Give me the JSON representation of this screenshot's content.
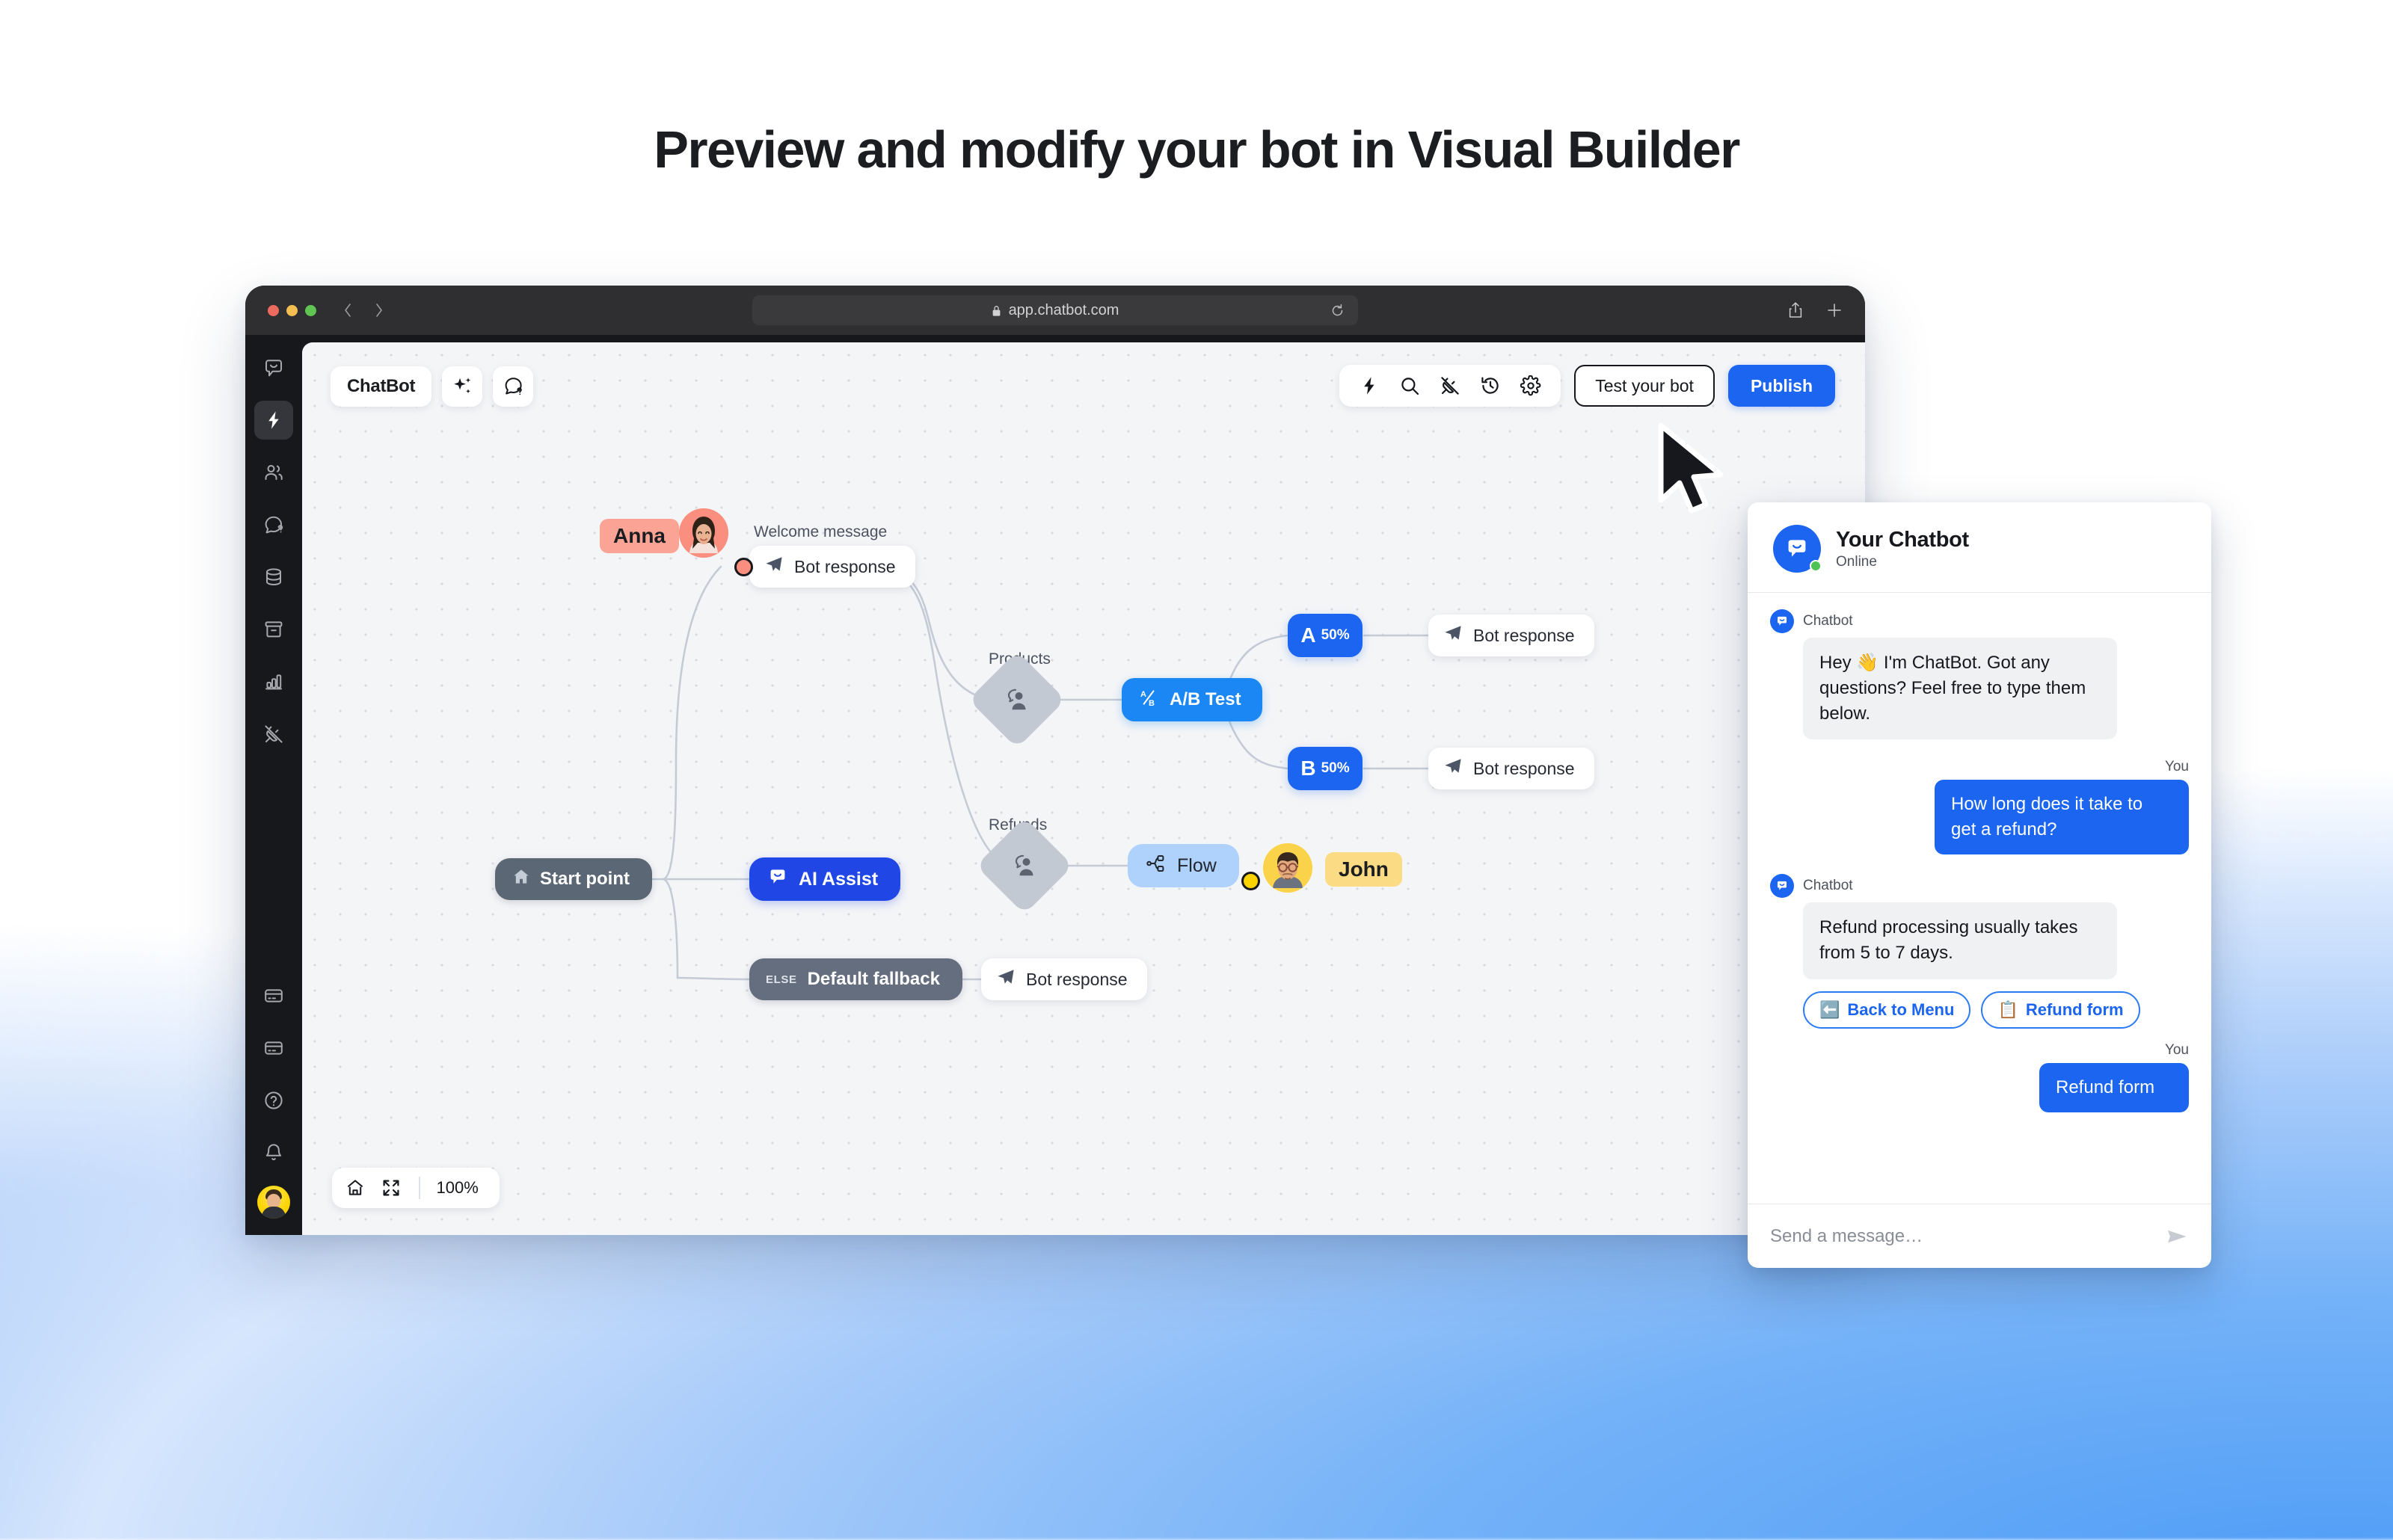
{
  "headline": "Preview and modify your bot in Visual Builder",
  "browser": {
    "url": "app.chatbot.com",
    "lock_icon": "lock-icon",
    "reload_icon": "reload-icon",
    "back_icon": "chevron-left-icon",
    "forward_icon": "chevron-right-icon",
    "share_icon": "share-icon",
    "newtab_icon": "plus-icon"
  },
  "sidebar": {
    "items": [
      {
        "icon": "chatbot-logo-icon",
        "name": "chatbot-logo",
        "active": false
      },
      {
        "icon": "bolt-icon",
        "name": "automations",
        "active": true
      },
      {
        "icon": "users-icon",
        "name": "contacts",
        "active": false
      },
      {
        "icon": "chat-question-icon",
        "name": "conversations",
        "active": false
      },
      {
        "icon": "database-icon",
        "name": "knowledge-base",
        "active": false
      },
      {
        "icon": "archive-icon",
        "name": "archive",
        "active": false
      },
      {
        "icon": "bar-chart-icon",
        "name": "analytics",
        "active": false
      },
      {
        "icon": "plug-icon",
        "name": "integrations",
        "active": false
      }
    ],
    "bottom_items": [
      {
        "icon": "card-icon",
        "name": "billing"
      },
      {
        "icon": "card-icon",
        "name": "subscription"
      },
      {
        "icon": "help-circle-icon",
        "name": "help"
      },
      {
        "icon": "bell-icon",
        "name": "notifications"
      }
    ],
    "avatar": "user-avatar"
  },
  "toolbar": {
    "brand": "ChatBot",
    "ai_icon": "sparkles-icon",
    "help_icon": "chat-question-icon",
    "icons": [
      {
        "icon": "bolt-icon",
        "name": "automations-icon"
      },
      {
        "icon": "search-icon",
        "name": "search-icon"
      },
      {
        "icon": "plug-icon",
        "name": "integrations-icon"
      },
      {
        "icon": "history-icon",
        "name": "history-icon"
      },
      {
        "icon": "gear-icon",
        "name": "settings-icon"
      }
    ],
    "test_label": "Test your bot",
    "publish_label": "Publish"
  },
  "canvas": {
    "nodes": {
      "start_point": "Start point",
      "ai_assist": "AI Assist",
      "welcome_label": "Welcome message",
      "welcome_bot_response": "Bot response",
      "products_label": "Products",
      "ab_test": "A/B Test",
      "variant_a_letter": "A",
      "variant_a_percent": "50%",
      "variant_a_response": "Bot response",
      "variant_b_letter": "B",
      "variant_b_percent": "50%",
      "variant_b_response": "Bot response",
      "refunds_label": "Refunds",
      "flow": "Flow",
      "fallback_tag": "ELSE",
      "fallback": "Default fallback",
      "fallback_response": "Bot response"
    },
    "collaborators": [
      {
        "name": "Anna",
        "color": "#fba394"
      },
      {
        "name": "John",
        "color": "#fbdc84"
      }
    ],
    "zoom_controls": {
      "home_icon": "home-icon",
      "fit_icon": "fit-screen-icon",
      "level": "100%"
    }
  },
  "widget": {
    "title": "Your Chatbot",
    "status": "Online",
    "avatar_icon": "chatbot-logo-icon",
    "messages": [
      {
        "sender": "Chatbot",
        "side": "bot",
        "text": "Hey 👋 I'm ChatBot. Got any questions? Feel free to type them below."
      },
      {
        "sender": "You",
        "side": "you",
        "text": "How long does it take to get a refund?"
      },
      {
        "sender": "Chatbot",
        "side": "bot",
        "text": "Refund processing usually takes from 5 to 7 days."
      },
      {
        "sender": "You",
        "side": "you",
        "text": "Refund form"
      }
    ],
    "quick_replies": [
      {
        "emoji": "⬅️",
        "label": "Back to Menu"
      },
      {
        "emoji": "📋",
        "label": "Refund form"
      }
    ],
    "input_placeholder": "Send a message…",
    "input_value": "",
    "send_icon": "send-icon"
  },
  "colors": {
    "accent_blue": "#1b65f0",
    "node_blue": "#1b87f5",
    "deep_blue": "#2046e6",
    "light_blue": "#aed2fb",
    "slate": "#5b6775",
    "anna": "#fba394",
    "john": "#fbdc84",
    "online_green": "#4ec254"
  }
}
